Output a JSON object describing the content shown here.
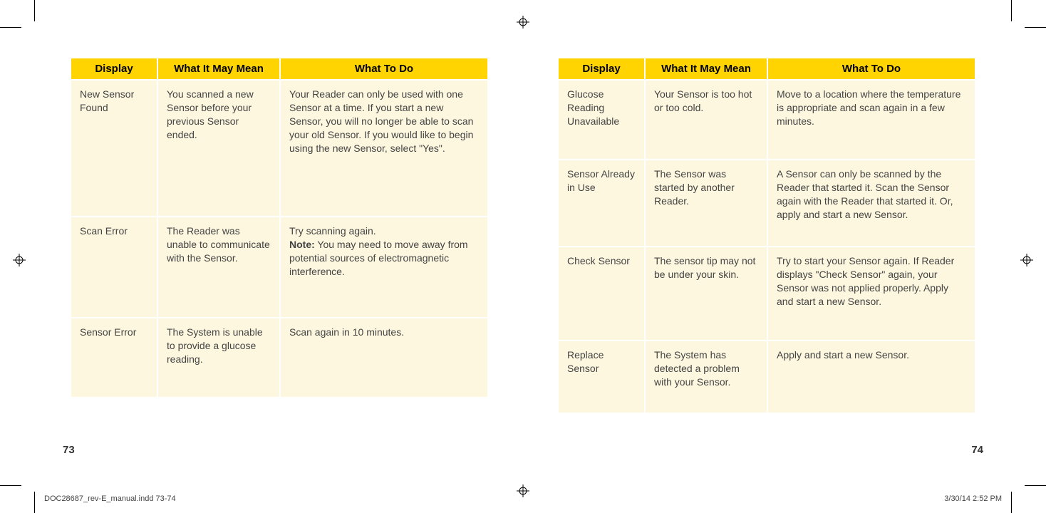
{
  "headers": {
    "display": "Display",
    "mean": "What It May Mean",
    "do": "What To Do"
  },
  "left": {
    "page_num": "73",
    "rows": [
      {
        "display": "New Sensor Found",
        "mean": "You scanned a new Sensor before your previous Sensor ended.",
        "do": "Your Reader can only be used with one Sensor at a time. If you start a new Sensor, you will no longer be able to scan your old Sensor. If you would like to begin using the new Sensor, select \"Yes\"."
      },
      {
        "display": "Scan Error",
        "mean": "The Reader was unable to communicate with the Sensor.",
        "do_line1": "Try scanning again.",
        "do_note_label": "Note:",
        "do_note_text": " You may need to move away from potential sources of electromagnetic interference."
      },
      {
        "display": "Sensor Error",
        "mean": "The System is unable to provide a glucose reading.",
        "do": "Scan again in 10 minutes."
      }
    ]
  },
  "right": {
    "page_num": "74",
    "rows": [
      {
        "display": "Glucose Reading Unavailable",
        "mean": "Your Sensor is too hot or too cold.",
        "do": "Move to a location where the temperature is appropriate and scan again in a few minutes."
      },
      {
        "display": "Sensor Already in Use",
        "mean": "The Sensor was started by another Reader.",
        "do": "A Sensor can only be scanned by the Reader that started it. Scan the Sensor again with the Reader that started it. Or, apply and start a new Sensor."
      },
      {
        "display": "Check Sensor",
        "mean": "The sensor tip may not be under your skin.",
        "do": "Try to start your Sensor again. If Reader displays \"Check Sensor\" again, your Sensor was not applied properly. Apply and start a new Sensor."
      },
      {
        "display": "Replace Sensor",
        "mean": "The System has detected a problem with your Sensor.",
        "do": "Apply and start a new Sensor."
      }
    ]
  },
  "footer": {
    "doc": "DOC28687_rev-E_manual.indd   73-74",
    "stamp": "3/30/14   2:52 PM"
  }
}
